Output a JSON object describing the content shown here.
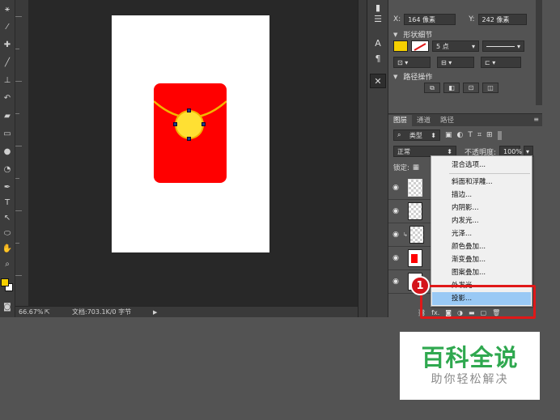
{
  "colors": {
    "foreground_swatch": "#f5d000",
    "background_swatch": "#ffffff",
    "envelope_red": "#ff0000",
    "coin_yellow": "#ffe033",
    "highlight_blue": "#99c9f5",
    "annotation_red": "#e01818",
    "watermark_green": "#2fa84f"
  },
  "toolbar": {
    "tools": [
      "magic-wand-icon",
      "eyedropper-icon",
      "healing-brush-icon",
      "brush-icon",
      "clone-stamp-icon",
      "history-brush-icon",
      "eraser-icon",
      "gradient-icon",
      "blur-icon",
      "dodge-icon",
      "pen-icon",
      "type-icon",
      "path-selection-icon",
      "shape-icon",
      "hand-icon",
      "zoom-icon"
    ]
  },
  "status_bar": {
    "zoom": "66.67%",
    "doc_info": "文档:703.1K/0 字节"
  },
  "properties": {
    "x_label": "X:",
    "x_value": "164 像素",
    "y_label": "Y:",
    "y_value": "242 像素",
    "shape_details_title": "形状细节",
    "stroke_size": "5 点",
    "path_ops_title": "路径操作"
  },
  "layers_panel": {
    "tabs": [
      "图层",
      "通道",
      "路径"
    ],
    "filter_kind": "类型",
    "blend_mode": "正常",
    "opacity_label": "不透明度:",
    "opacity_value": "100%",
    "lock_label": "锁定:",
    "footer_fx": "fx."
  },
  "context_menu": {
    "items": [
      "混合选项...",
      "斜面和浮雕...",
      "描边...",
      "内阴影...",
      "内发光...",
      "光泽...",
      "颜色叠加...",
      "渐变叠加...",
      "图案叠加...",
      "外发光...",
      "投影..."
    ],
    "highlighted": "投影..."
  },
  "annotation": {
    "step_number": "1"
  },
  "watermark": {
    "title": "百科全说",
    "subtitle": "助你轻松解决"
  }
}
